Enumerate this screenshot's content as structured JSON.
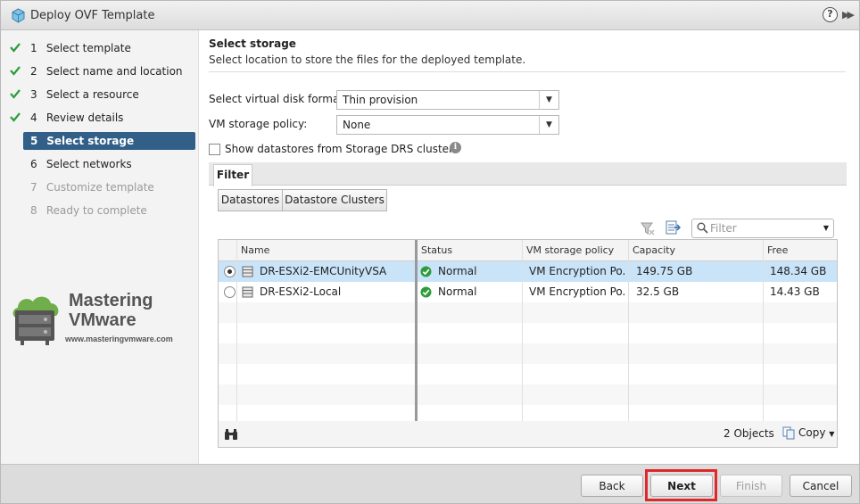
{
  "window": {
    "title": "Deploy OVF Template"
  },
  "steps": [
    {
      "num": "1",
      "label": "Select template",
      "state": "done"
    },
    {
      "num": "2",
      "label": "Select name and location",
      "state": "done"
    },
    {
      "num": "3",
      "label": "Select a resource",
      "state": "done"
    },
    {
      "num": "4",
      "label": "Review details",
      "state": "done"
    },
    {
      "num": "5",
      "label": "Select storage",
      "state": "active"
    },
    {
      "num": "6",
      "label": "Select networks",
      "state": "enabled"
    },
    {
      "num": "7",
      "label": "Customize template",
      "state": "disabled"
    },
    {
      "num": "8",
      "label": "Ready to complete",
      "state": "disabled"
    }
  ],
  "watermark": {
    "line1": "Mastering",
    "line2": "VMware",
    "url": "www.masteringvmware.com"
  },
  "page": {
    "heading": "Select storage",
    "subheading": "Select location to store the files for the deployed template."
  },
  "disk_format": {
    "label": "Select virtual disk format:",
    "value": "Thin provision"
  },
  "storage_policy": {
    "label": "VM storage policy:",
    "value": "None"
  },
  "show_drs": {
    "label": "Show datastores from Storage DRS clusters",
    "checked": false
  },
  "filter_tab": "Filter",
  "segments": [
    "Datastores",
    "Datastore Clusters"
  ],
  "filter_input": {
    "placeholder": "Filter"
  },
  "grid": {
    "columns": [
      "Name",
      "Status",
      "VM storage policy",
      "Capacity",
      "Free"
    ],
    "rows": [
      {
        "name": "DR-ESXi2-EMCUnityVSA",
        "status": "Normal",
        "policy": "VM Encryption Po...",
        "capacity": "149.75  GB",
        "free": "148.34  GB",
        "selected": true
      },
      {
        "name": "DR-ESXi2-Local",
        "status": "Normal",
        "policy": "VM Encryption Po...",
        "capacity": "32.5  GB",
        "free": "14.43  GB",
        "selected": false
      }
    ],
    "object_count": "2 Objects",
    "copy_label": "Copy"
  },
  "buttons": {
    "back": "Back",
    "next": "Next",
    "finish": "Finish",
    "cancel": "Cancel"
  },
  "colors": {
    "active_step": "#315f88",
    "selected_row": "#c9e4f9",
    "highlight": "#e0282c",
    "check": "#2e9c3c"
  }
}
